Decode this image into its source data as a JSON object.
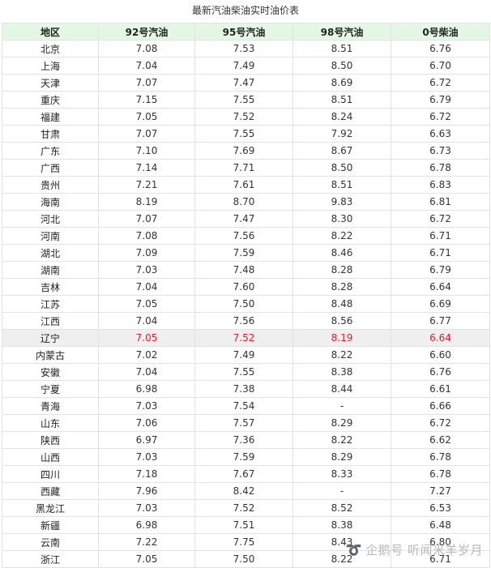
{
  "title": "最新汽油柴油实时油价表",
  "table": {
    "headers": [
      "地区",
      "92号汽油",
      "95号汽油",
      "98号汽油",
      "0号柴油"
    ],
    "rows": [
      [
        "北京",
        "7.08",
        "7.53",
        "8.51",
        "6.76"
      ],
      [
        "上海",
        "7.04",
        "7.49",
        "8.50",
        "6.70"
      ],
      [
        "天津",
        "7.07",
        "7.47",
        "8.69",
        "6.72"
      ],
      [
        "重庆",
        "7.15",
        "7.55",
        "8.51",
        "6.79"
      ],
      [
        "福建",
        "7.05",
        "7.52",
        "8.24",
        "6.72"
      ],
      [
        "甘肃",
        "7.07",
        "7.55",
        "7.92",
        "6.63"
      ],
      [
        "广东",
        "7.10",
        "7.69",
        "8.67",
        "6.73"
      ],
      [
        "广西",
        "7.14",
        "7.71",
        "8.50",
        "6.78"
      ],
      [
        "贵州",
        "7.21",
        "7.61",
        "8.51",
        "6.83"
      ],
      [
        "海南",
        "8.19",
        "8.70",
        "9.83",
        "6.81"
      ],
      [
        "河北",
        "7.07",
        "7.47",
        "8.30",
        "6.72"
      ],
      [
        "河南",
        "7.08",
        "7.56",
        "8.22",
        "6.71"
      ],
      [
        "湖北",
        "7.09",
        "7.59",
        "8.46",
        "6.71"
      ],
      [
        "湖南",
        "7.03",
        "7.48",
        "8.28",
        "6.79"
      ],
      [
        "吉林",
        "7.04",
        "7.60",
        "8.28",
        "6.64"
      ],
      [
        "江苏",
        "7.05",
        "7.50",
        "8.48",
        "6.69"
      ],
      [
        "江西",
        "7.04",
        "7.56",
        "8.56",
        "6.77"
      ],
      [
        "辽宁",
        "7.05",
        "7.52",
        "8.19",
        "6.64"
      ],
      [
        "内蒙古",
        "7.02",
        "7.49",
        "8.22",
        "6.60"
      ],
      [
        "安徽",
        "7.04",
        "7.55",
        "8.38",
        "6.76"
      ],
      [
        "宁夏",
        "6.98",
        "7.38",
        "8.44",
        "6.61"
      ],
      [
        "青海",
        "7.03",
        "7.54",
        "-",
        "6.66"
      ],
      [
        "山东",
        "7.06",
        "7.57",
        "8.29",
        "6.72"
      ],
      [
        "陕西",
        "6.97",
        "7.36",
        "8.22",
        "6.62"
      ],
      [
        "山西",
        "7.03",
        "7.59",
        "8.29",
        "6.78"
      ],
      [
        "四川",
        "7.18",
        "7.67",
        "8.33",
        "6.78"
      ],
      [
        "西藏",
        "7.96",
        "8.42",
        "-",
        "7.27"
      ],
      [
        "黑龙江",
        "7.03",
        "7.52",
        "8.52",
        "6.53"
      ],
      [
        "新疆",
        "6.98",
        "7.51",
        "8.38",
        "6.48"
      ],
      [
        "云南",
        "7.22",
        "7.75",
        "8.43",
        "6.80"
      ],
      [
        "浙江",
        "7.05",
        "7.50",
        "8.22",
        "6.71"
      ]
    ],
    "highlight_row": "辽宁",
    "colors": {
      "header_bg": "#e4f6e4",
      "highlight_bg": "#efefef",
      "highlight_text": "#e21b2b"
    }
  },
  "watermark": {
    "logo": "➰",
    "text": "企鹅号 听闻米羊岁月"
  }
}
